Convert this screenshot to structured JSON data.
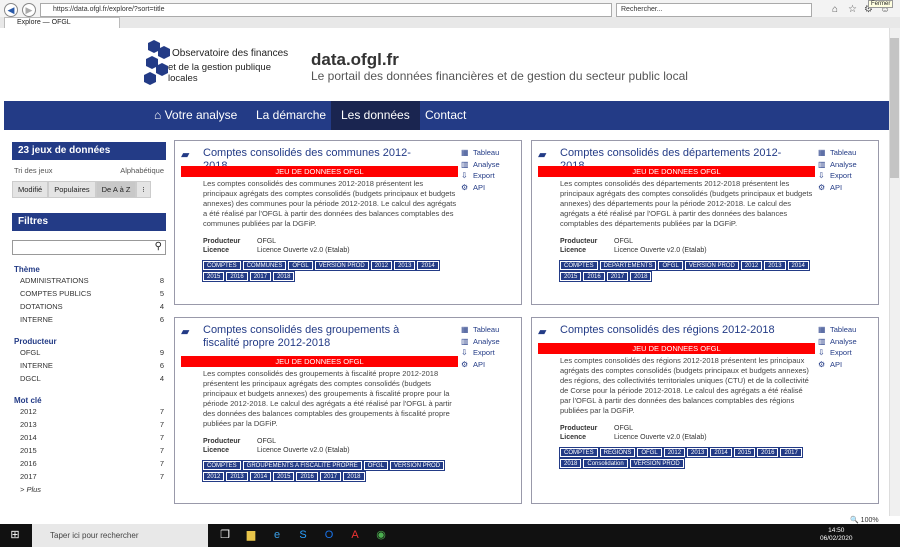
{
  "browser": {
    "url": "https://data.ofgl.fr/explore/?sort=title",
    "search_placeholder": "Rechercher...",
    "tab_title": "Explore — OFGL",
    "tooltip": "Fermer"
  },
  "header": {
    "logo_line1": "Observatoire des finances",
    "logo_line2": "et de la gestion publique locales",
    "site_name": "data.ofgl.fr",
    "site_subtitle": "Le portail des données financières et de gestion du secteur public local"
  },
  "nav": [
    "Votre analyse",
    "La démarche",
    "Les données",
    "Contact"
  ],
  "sidebar": {
    "count_title": "23 jeux de données",
    "sort_label": "Tri des jeux",
    "sort_value": "Alphabétique",
    "sort_buttons": [
      "Modifié",
      "Populaires",
      "De A à Z",
      "⁝"
    ],
    "filters_title": "Filtres",
    "theme": {
      "title": "Thème",
      "items": [
        [
          "ADMINISTRATIONS",
          "8"
        ],
        [
          "COMPTES PUBLICS",
          "5"
        ],
        [
          "DOTATIONS",
          "4"
        ],
        [
          "INTERNE",
          "6"
        ]
      ]
    },
    "producteur": {
      "title": "Producteur",
      "items": [
        [
          "OFGL",
          "9"
        ],
        [
          "INTERNE",
          "6"
        ],
        [
          "DGCL",
          "4"
        ]
      ]
    },
    "motcle": {
      "title": "Mot clé",
      "items": [
        [
          "2012",
          "7"
        ],
        [
          "2013",
          "7"
        ],
        [
          "2014",
          "7"
        ],
        [
          "2015",
          "7"
        ],
        [
          "2016",
          "7"
        ],
        [
          "2017",
          "7"
        ]
      ]
    },
    "more": "> Plus"
  },
  "actions": [
    "Tableau",
    "Analyse",
    "Export",
    "API"
  ],
  "band": "JEU DE DONNEES OFGL",
  "producteur_label": "Producteur",
  "licence_label": "Licence",
  "cards": [
    {
      "title": "Comptes consolidés des communes 2012-2018",
      "desc": "Les comptes consolidés des communes 2012-2018 présentent les principaux agrégats des comptes consolidés (budgets principaux et budgets annexes) des communes pour la période 2012-2018. Le calcul des agrégats a été réalisé par l'OFGL à partir des données des balances comptables des communes publiées par la DGFiP.",
      "producteur": "OFGL",
      "licence": "Licence Ouverte v2.0 (Etalab)",
      "tags": [
        "COMPTES",
        "COMMUNES",
        "OFGL",
        "VERSION PROD",
        "2012",
        "2013",
        "2014",
        "2015",
        "2016",
        "2017",
        "2018"
      ]
    },
    {
      "title": "Comptes consolidés des départements 2012-2018",
      "desc": "Les comptes consolidés des départements 2012-2018 présentent les principaux agrégats des comptes consolidés (budgets principaux et budgets annexes) des départements pour la période 2012-2018. Le calcul des agrégats a été réalisé par l'OFGL à partir des données des balances comptables des départements publiées par la DGFiP.",
      "producteur": "OFGL",
      "licence": "Licence Ouverte v2.0 (Etalab)",
      "tags": [
        "COMPTES",
        "DEPARTEMENTS",
        "OFGL",
        "VERSION PROD",
        "2012",
        "2013",
        "2014",
        "2015",
        "2016",
        "2017",
        "2018"
      ]
    },
    {
      "title": "Comptes consolidés des groupements à fiscalité propre 2012-2018",
      "desc": "Les comptes consolidés des groupements à fiscalité propre 2012-2018 présentent les principaux agrégats des comptes consolidés (budgets principaux et budgets annexes) des groupements à fiscalité propre pour la période 2012-2018. Le calcul des agrégats a été réalisé par l'OFGL à partir des données des balances comptables des groupements à fiscalité propre publiées par la DGFiP.",
      "producteur": "OFGL",
      "licence": "Licence Ouverte v2.0 (Etalab)",
      "tags": [
        "COMPTES",
        "GROUPEMENTS A FISCALITE PROPRE",
        "OFGL",
        "VERSION PROD",
        "2012",
        "2013",
        "2014",
        "2015",
        "2016",
        "2017",
        "2018"
      ]
    },
    {
      "title": "Comptes consolidés des régions 2012-2018",
      "desc": "Les comptes consolidés des régions 2012-2018 présentent les principaux agrégats des comptes consolidés (budgets principaux et budgets annexes) des régions, des collectivités territoriales uniques (CTU) et de la collectivité de Corse pour la période 2012-2018. Le calcul des agrégats a été réalisé par l'OFGL à partir des données des balances comptables des régions publiées par la DGFiP.",
      "producteur": "OFGL",
      "licence": "Licence Ouverte v2.0 (Etalab)",
      "tags": [
        "COMPTES",
        "REGIONS",
        "OFGL",
        "2012",
        "2013",
        "2014",
        "2015",
        "2016",
        "2017",
        "2018",
        "Consolidation",
        "VERSION PROD"
      ]
    }
  ],
  "status": {
    "zoom": "100%",
    "time": "14:50",
    "date": "06/02/2020"
  },
  "taskbar": {
    "search_placeholder": "Taper ici pour rechercher"
  }
}
